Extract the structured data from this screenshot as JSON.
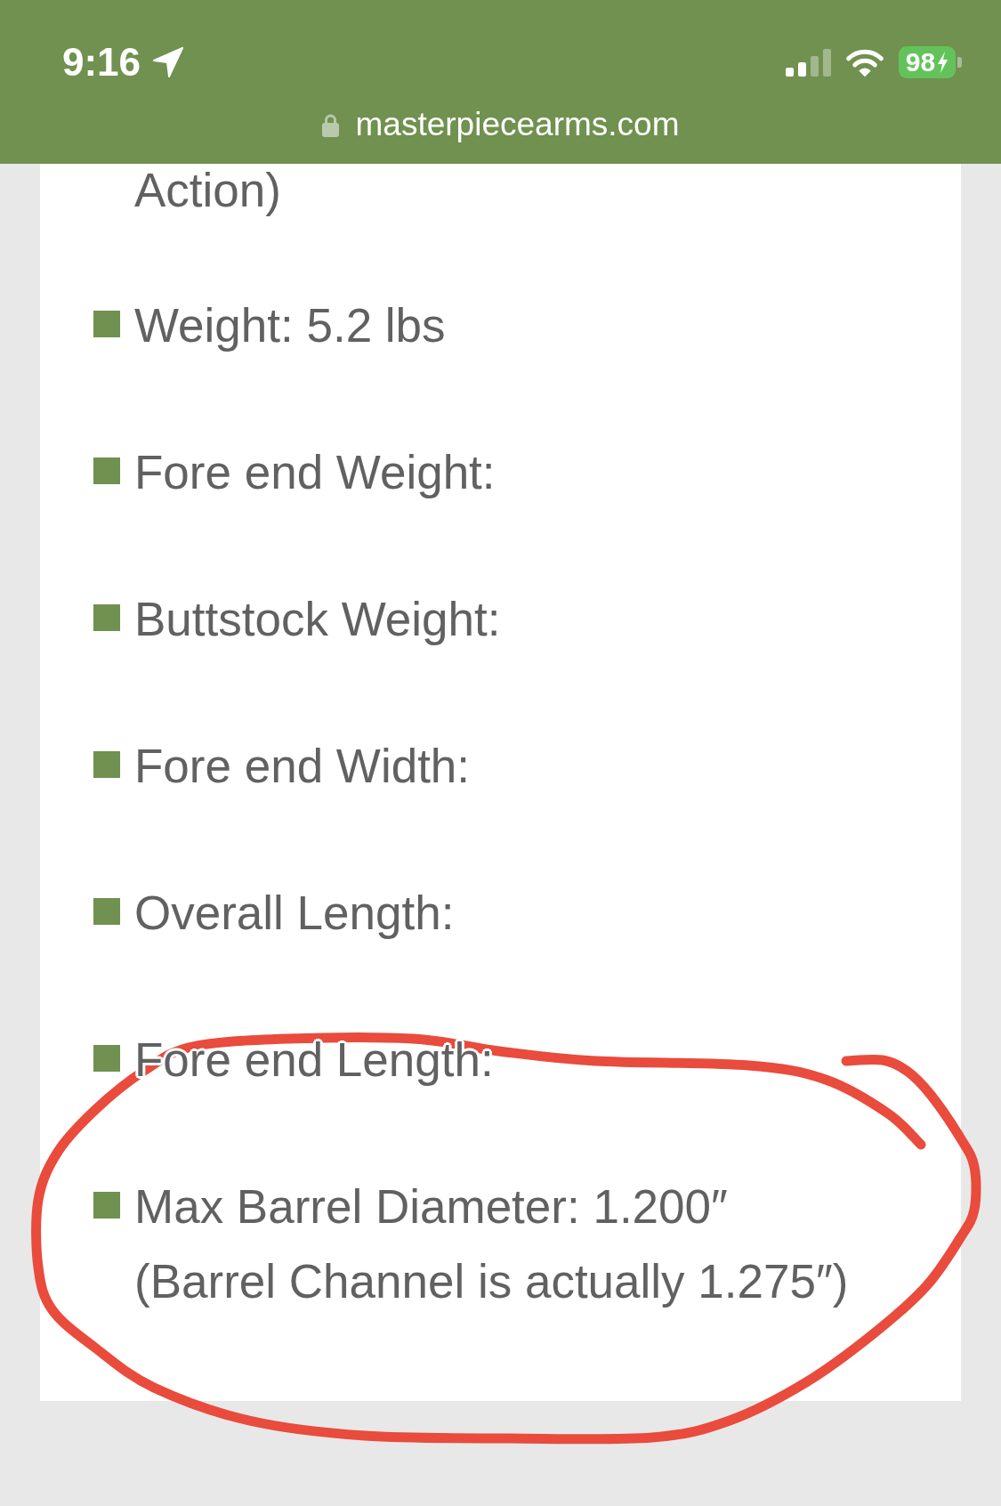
{
  "status_bar": {
    "time": "9:16",
    "battery": "98"
  },
  "address_bar": {
    "url": "masterpiecearms.com"
  },
  "content": {
    "continued_text": "Action)",
    "spec_items": [
      {
        "text": "Weight: 5.2 lbs",
        "circled": false
      },
      {
        "text": "Fore end Weight:",
        "circled": false
      },
      {
        "text": "Buttstock Weight:",
        "circled": false
      },
      {
        "text": "Fore end Width:",
        "circled": false
      },
      {
        "text": "Overall Length:",
        "circled": false
      },
      {
        "text": "Fore end Length:",
        "circled": false
      },
      {
        "text": "Max Barrel Diameter: 1.200″\n(Barrel Channel is actually 1.275″)",
        "circled": true
      }
    ]
  }
}
